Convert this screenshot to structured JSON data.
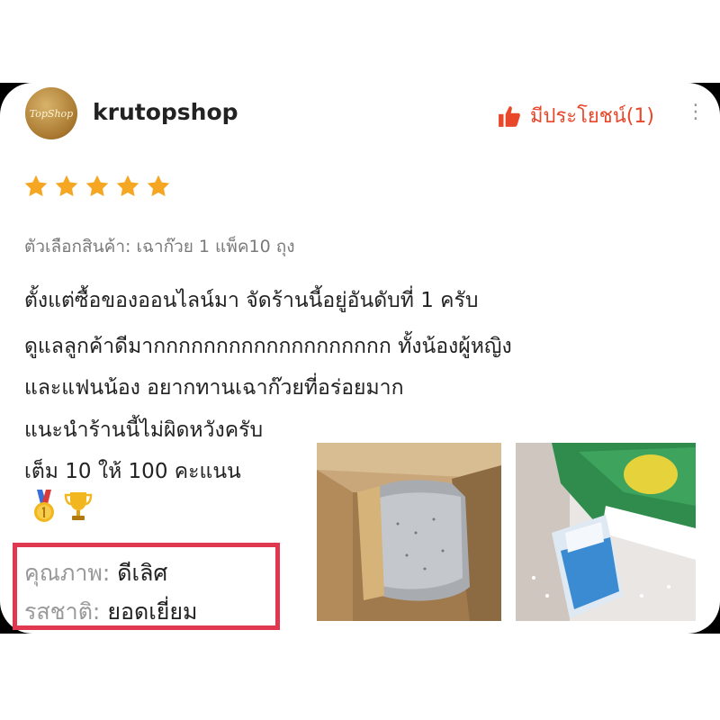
{
  "reviewer": {
    "avatar_text": "TopShop",
    "username": "krutopshop"
  },
  "helpful": {
    "label": "มีประโยชน์(1)",
    "icon": "thumbs-up-icon",
    "color": "#e8472a"
  },
  "more": {
    "label": "⋮"
  },
  "rating": {
    "stars": 5,
    "max": 5,
    "color": "#f5a623"
  },
  "variant": "ตัวเลือกสินค้า: เฉาก๊วย 1 แพ็ค10 ถุง",
  "review_lines": [
    "ตั้งแต่ซื้อของออนไลน์มา จัดร้านนี้อยู่อันดับที่ 1 ครับ",
    "ดูแลลูกค้าดีมากกกกกกกกกกกกกกกกกกก ทั้งน้องผู้หญิง",
    "และแฟนน้อง  อยากทานเฉาก๊วยที่อร่อยมาก",
    "แนะนำร้านนี้ไม่ผิดหวังครับ",
    "เต็ม 10 ให้ 100 คะแนน"
  ],
  "emojis": [
    "gold-medal-icon",
    "trophy-icon"
  ],
  "attributes": {
    "quality": {
      "key": "คุณภาพ:",
      "value": "ดีเลิศ"
    },
    "taste": {
      "key": "รสชาติ:",
      "value": "ยอดเยี่ยม"
    }
  },
  "highlight_color": "#e0384f",
  "photos": [
    {
      "name": "review-photo-box"
    },
    {
      "name": "review-photo-bags"
    }
  ]
}
